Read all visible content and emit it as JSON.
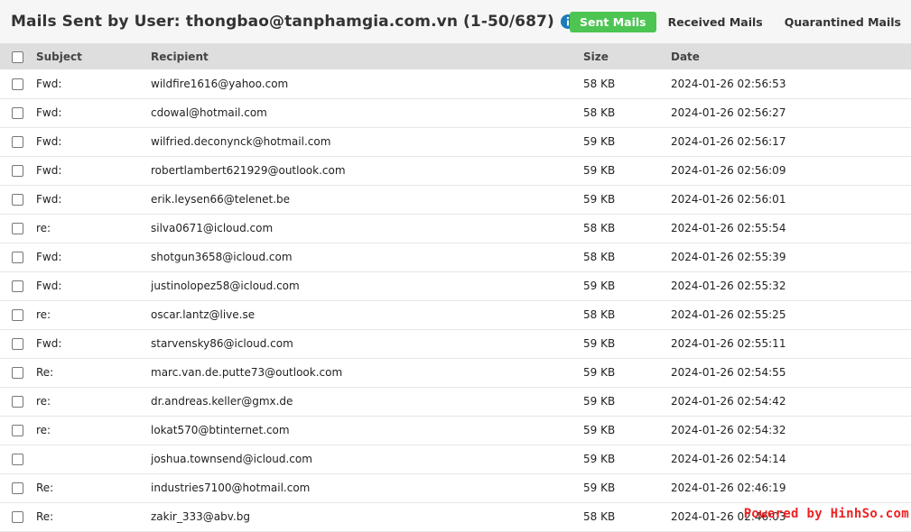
{
  "header": {
    "title": "Mails Sent by User: thongbao@tanphamgia.com.vn (1-50/687)",
    "icons": [
      "info-icon",
      "zoom-in-icon",
      "gear-icon"
    ],
    "accent": "#1a7bb9"
  },
  "tabs": [
    {
      "label": "Sent Mails",
      "active": true
    },
    {
      "label": "Received Mails",
      "active": false
    },
    {
      "label": "Quarantined Mails",
      "active": false
    }
  ],
  "table": {
    "columns": [
      "Subject",
      "Recipient",
      "Size",
      "Date"
    ],
    "rows": [
      {
        "subject": "Fwd:",
        "recipient": "wildfire1616@yahoo.com",
        "size": "58 KB",
        "date": "2024-01-26 02:56:53"
      },
      {
        "subject": "Fwd:",
        "recipient": "cdowal@hotmail.com",
        "size": "58 KB",
        "date": "2024-01-26 02:56:27"
      },
      {
        "subject": "Fwd:",
        "recipient": "wilfried.deconynck@hotmail.com",
        "size": "59 KB",
        "date": "2024-01-26 02:56:17"
      },
      {
        "subject": "Fwd:",
        "recipient": "robertlambert621929@outlook.com",
        "size": "59 KB",
        "date": "2024-01-26 02:56:09"
      },
      {
        "subject": "Fwd:",
        "recipient": "erik.leysen66@telenet.be",
        "size": "59 KB",
        "date": "2024-01-26 02:56:01"
      },
      {
        "subject": "re:",
        "recipient": "silva0671@icloud.com",
        "size": "58 KB",
        "date": "2024-01-26 02:55:54"
      },
      {
        "subject": "Fwd:",
        "recipient": "shotgun3658@icloud.com",
        "size": "58 KB",
        "date": "2024-01-26 02:55:39"
      },
      {
        "subject": "Fwd:",
        "recipient": "justinolopez58@icloud.com",
        "size": "59 KB",
        "date": "2024-01-26 02:55:32"
      },
      {
        "subject": "re:",
        "recipient": "oscar.lantz@live.se",
        "size": "58 KB",
        "date": "2024-01-26 02:55:25"
      },
      {
        "subject": "Fwd:",
        "recipient": "starvensky86@icloud.com",
        "size": "59 KB",
        "date": "2024-01-26 02:55:11"
      },
      {
        "subject": "Re:",
        "recipient": "marc.van.de.putte73@outlook.com",
        "size": "59 KB",
        "date": "2024-01-26 02:54:55"
      },
      {
        "subject": "re:",
        "recipient": "dr.andreas.keller@gmx.de",
        "size": "59 KB",
        "date": "2024-01-26 02:54:42"
      },
      {
        "subject": "re:",
        "recipient": "lokat570@btinternet.com",
        "size": "59 KB",
        "date": "2024-01-26 02:54:32"
      },
      {
        "subject": "",
        "recipient": "joshua.townsend@icloud.com",
        "size": "59 KB",
        "date": "2024-01-26 02:54:14"
      },
      {
        "subject": "Re:",
        "recipient": "industries7100@hotmail.com",
        "size": "59 KB",
        "date": "2024-01-26 02:46:19"
      },
      {
        "subject": "Re:",
        "recipient": "zakir_333@abv.bg",
        "size": "58 KB",
        "date": "2024-01-26 02:46:03"
      }
    ]
  },
  "watermark": "Powered by HinhSo.com"
}
